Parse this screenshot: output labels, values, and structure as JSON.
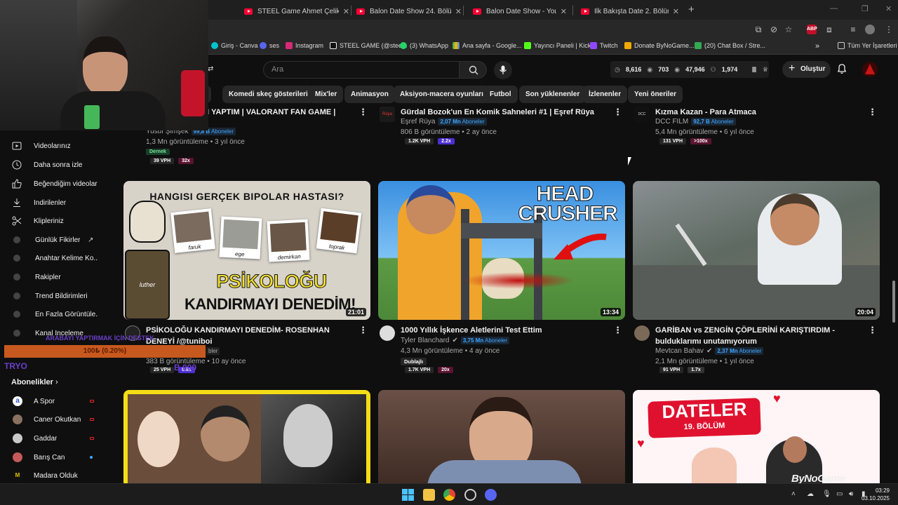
{
  "browser": {
    "tabs": [
      {
        "title": "STEEL Game Ahmet Çelik - You"
      },
      {
        "title": "Balon Date Show 24. Bölüm - Y"
      },
      {
        "title": "Balon Date Show - YouTube"
      },
      {
        "title": "İlk Bakışta Date 2. Bölüm - You"
      }
    ],
    "bookmarks": [
      {
        "label": "Giriş - Canva",
        "color": "#00c4cc"
      },
      {
        "label": "ses",
        "color": "#5865f2"
      },
      {
        "label": "Instagram",
        "color": "#d62976"
      },
      {
        "label": "STEEL GAME (@stee...",
        "color": "#ffffff"
      },
      {
        "label": "(3) WhatsApp",
        "color": "#25d366"
      },
      {
        "label": "Ana sayfa - Google...",
        "color": "#fbbc04"
      },
      {
        "label": "Yayıncı Paneli | Kick",
        "color": "#53fc18"
      },
      {
        "label": "Twitch",
        "color": "#9146ff"
      },
      {
        "label": "Donate ByNoGame...",
        "color": "#f2a900"
      },
      {
        "label": "(20) Chat Box / Stre...",
        "color": "#34a853"
      }
    ],
    "bookmarks_more": "»",
    "all_bookmarks": "Tüm Yer İşaretleri"
  },
  "youtube": {
    "search_placeholder": "Ara",
    "stats": {
      "views": "8,616",
      "watch": "703",
      "subs": "47,946",
      "other": "1,974"
    },
    "create_label": "Oluştur",
    "chips": [
      "Komedi skeç gösterileri",
      "Mix'ler",
      "Animasyon",
      "Aksiyon-macera oyunları",
      "Futbol",
      "Son yüklenenler",
      "İzlenenler",
      "Yeni öneriler"
    ],
    "chip_partial": "n",
    "sidebar": [
      {
        "label": "Videolarınız",
        "icon": "video-icon"
      },
      {
        "label": "Daha sonra izle",
        "icon": "clock-icon"
      },
      {
        "label": "Beğendiğim videolar",
        "icon": "thumb-up-icon"
      },
      {
        "label": "İndirilenler",
        "icon": "download-icon"
      },
      {
        "label": "Klipleriniz",
        "icon": "scissors-icon"
      },
      {
        "label": "Günlük Fikirler",
        "icon": "extension-icon"
      },
      {
        "label": "Anahtar Kelime Ko...",
        "icon": "extension-icon"
      },
      {
        "label": "Rakipler",
        "icon": "extension-icon"
      },
      {
        "label": "Trend Bildirimleri",
        "icon": "extension-icon"
      },
      {
        "label": "En Fazla Görüntüle...",
        "icon": "extension-icon"
      },
      {
        "label": "Kanal İnceleme",
        "icon": "extension-icon"
      }
    ],
    "subscriptions_header": "Abonelikler",
    "channels": [
      {
        "name": "A Spor",
        "color": "#e7e7e7",
        "status": "live"
      },
      {
        "name": "Caner Okutkan",
        "color": "#8a7060",
        "status": "live"
      },
      {
        "name": "Gaddar",
        "color": "#c9c9c9",
        "status": "live"
      },
      {
        "name": "Barış Can",
        "color": "#c45a5a",
        "status": "new"
      },
      {
        "name": "Madara Olduk",
        "color": "#e0c000",
        "status": ""
      }
    ],
    "top_row": [
      {
        "title_line": "MI YAPTIM | VALORANT FAN GAME |",
        "channel": "Yusuf Şimşek",
        "subs_count": "99,8 B",
        "subs_word": "Aboneler",
        "meta": "1,3 Mn görüntüleme • 3 yıl önce",
        "tag": "Dernek",
        "vph": "39 VPH",
        "mult": "32x"
      },
      {
        "title_line": "Gürdal Bozok'un En Komik Sahneleri #1 | Eşref Rüya",
        "channel": "Eşref Rüya",
        "subs_count": "2,07 Mn",
        "subs_word": "Aboneler",
        "meta": "806 B görüntüleme • 2 ay önce",
        "vph": "1.2K VPH",
        "mult": "2.2x"
      },
      {
        "title_line": "Kızma Kazan - Para Atmaca",
        "channel": "DCC FILM",
        "subs_count": "92,7 B",
        "subs_word": "Aboneler",
        "meta": "5,4 Mn görüntüleme • 6 yıl önce",
        "vph": "131 VPH",
        "mult": ">100x"
      }
    ],
    "videos": [
      {
        "thumb_text_top": "HANGISI GERÇEK BIPOLAR HASTASI?",
        "thumb_text_big1": "PSİKOLOĞU",
        "thumb_text_big2": "KANDIRMAYI DENEDİM!",
        "names": [
          "faruk",
          "ege",
          "demirkan",
          "toprak"
        ],
        "char": "luther",
        "duration": "21:01",
        "title": "PSİKOLOĞU KANDIRMAYI DENEDİM- ROSENHAN DENEYİ /@tuniboi",
        "channel": "",
        "subs_word": "bler",
        "meta": "383 B görüntüleme • 10 ay önce",
        "vph": "25 VPH",
        "mult": "9.6x"
      },
      {
        "thumb_text1": "HEAD",
        "thumb_text2": "CRUSHER",
        "duration": "13:34",
        "title": "1000 Yıllık İşkence Aletlerini Test Ettim",
        "channel": "Tyler Blanchard",
        "subs_count": "3,75 Mn",
        "subs_word": "Aboneler",
        "meta": "4,3 Mn görüntüleme • 4 ay önce",
        "tag": "Dublajlı",
        "vph": "1.7K VPH",
        "mult": "20x"
      },
      {
        "duration": "20:04",
        "title": "GARİBAN vs ZENGİN ÇÖPLERİNİ KARIŞTIRDIM - bulduklarımı unutamıyorum",
        "channel": "Mevtcan Bahav",
        "subs_count": "2,37 Mn",
        "subs_word": "Aboneler",
        "meta": "2,1 Mn görüntüleme • 1 yıl önce",
        "vph": "91 VPH",
        "mult": "1.7x"
      }
    ],
    "bottom_row": [
      {
        "title": ""
      },
      {
        "title": ""
      },
      {
        "thumb_title": "DATELER",
        "thumb_sub": "19. BÖLÜM"
      }
    ]
  },
  "overlay": {
    "stream_text": "ARABAYI YAPTIRMAK İÇİN DESTEK",
    "goal": "100₺ (0.20%)",
    "tryo": "TRYO",
    "b_text": "B.000",
    "watermark": "ByNoGame"
  },
  "taskbar": {
    "time": "03:29",
    "date": "03.10.2025"
  },
  "colors": {
    "accent": "#ff0033",
    "link": "#3ea6ff",
    "bg": "#0f0f0f"
  }
}
